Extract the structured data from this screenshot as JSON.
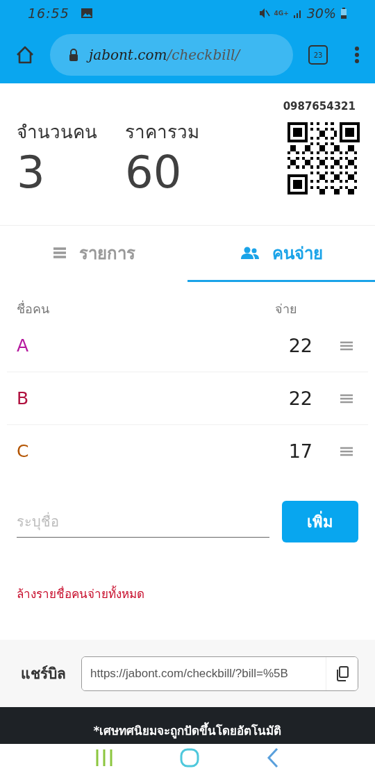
{
  "status_bar": {
    "time": "16:55",
    "network": "4G+",
    "battery": "30%"
  },
  "browser": {
    "domain": "jabont.com",
    "path": "/checkbill/",
    "tab_count": "23"
  },
  "summary": {
    "phone": "0987654321",
    "people_label": "จำนวนคน",
    "people_value": "3",
    "total_label": "ราคารวม",
    "total_value": "60"
  },
  "tabs": [
    {
      "label": "รายการ",
      "kind": "list",
      "selected": false
    },
    {
      "label": "คนจ่าย",
      "kind": "people",
      "selected": true
    }
  ],
  "table": {
    "columns": [
      "ชื่อคน",
      "จ่าย"
    ],
    "rows": [
      {
        "name": "A",
        "color": "#b5179e",
        "paid": "22"
      },
      {
        "name": "B",
        "color": "#b0123f",
        "paid": "22"
      },
      {
        "name": "C",
        "color": "#b35400",
        "paid": "17"
      }
    ]
  },
  "add_form": {
    "placeholder": "ระบุชื่อ",
    "button": "เพิ่ม"
  },
  "clear_link": "ล้างรายชื่อคนจ่ายทั้งหมด",
  "share": {
    "label": "แชร์บิล",
    "url": "https://jabont.com/checkbill/?bill=%5B"
  },
  "footer_note": "*เศษทศนิยมจะถูกปัดขึ้นโดยอัตโนมัติ"
}
